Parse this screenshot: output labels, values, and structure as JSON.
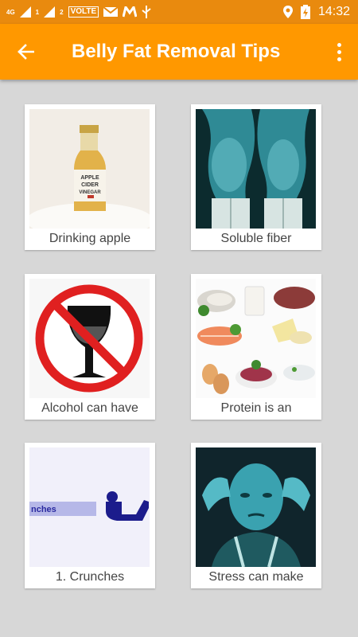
{
  "status_bar": {
    "network_label_1": "4G",
    "network_label_2": "1",
    "network_label_3": "2",
    "volte": "VOLTE",
    "time": "14:32",
    "icons": [
      "signal-icon",
      "signal-icon",
      "mail-icon",
      "m-app-icon",
      "usb-icon",
      "location-icon",
      "battery-icon"
    ]
  },
  "app_bar": {
    "title": "Belly Fat Removal Tips",
    "back_icon": "arrow-back-icon",
    "menu_icon": "more-vert-icon",
    "color": "#ff9800"
  },
  "tips": [
    {
      "caption": "Drinking apple",
      "image": "apple-cider-vinegar-bottle",
      "bottle_label": [
        "APPLE",
        "CIDER",
        "VINEGAR"
      ]
    },
    {
      "caption": "Soluble fiber",
      "image": "belly-xray"
    },
    {
      "caption": "Alcohol can have",
      "image": "no-alcohol-sign"
    },
    {
      "caption": "Protein is an",
      "image": "protein-foods"
    },
    {
      "caption": "1. Crunches",
      "image": "crunches-exercise",
      "slide_text": "nches"
    },
    {
      "caption": "Stress can make",
      "image": "stressed-person"
    }
  ]
}
